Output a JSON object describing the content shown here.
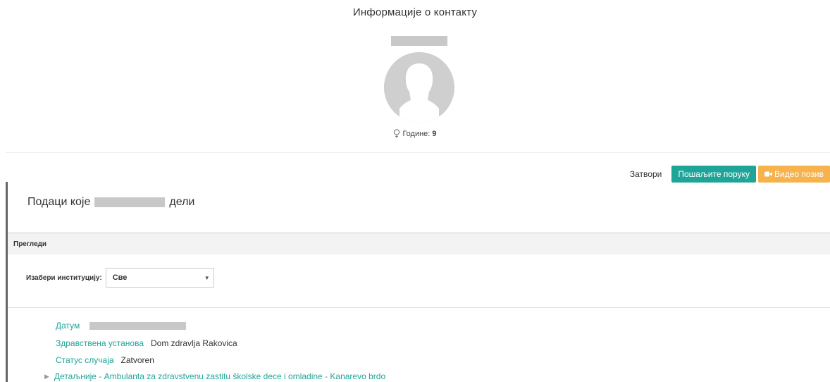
{
  "header": {
    "title": "Информације о контакту"
  },
  "profile": {
    "age_label": "Године:",
    "age_value": "9",
    "gender_icon": "female-icon",
    "avatar_icon": "user-silhouette-icon"
  },
  "actions": {
    "close_label": "Затвори",
    "message_label": "Пошаљите поруку",
    "video_label": "Видео позив",
    "video_icon": "video-camera-icon"
  },
  "share": {
    "prefix": "Подаци које",
    "suffix": "дели"
  },
  "section": {
    "title": "Прегледи"
  },
  "institution": {
    "label": "Изабери институцију:",
    "selected": "Све"
  },
  "record": {
    "date_label": "Датум",
    "facility_label": "Здравствена установа",
    "facility_value": "Dom zdravlja Rakovica",
    "status_label": "Статус случаја",
    "status_value": "Zatvoren",
    "details_link": "Детаљније - Ambulanta za zdravstvenu zastitu školske dece i omladine - Kanarevo brdo"
  },
  "colors": {
    "teal": "#1fa598",
    "orange": "#f6b24b",
    "redaction": "#c8c8c8"
  }
}
